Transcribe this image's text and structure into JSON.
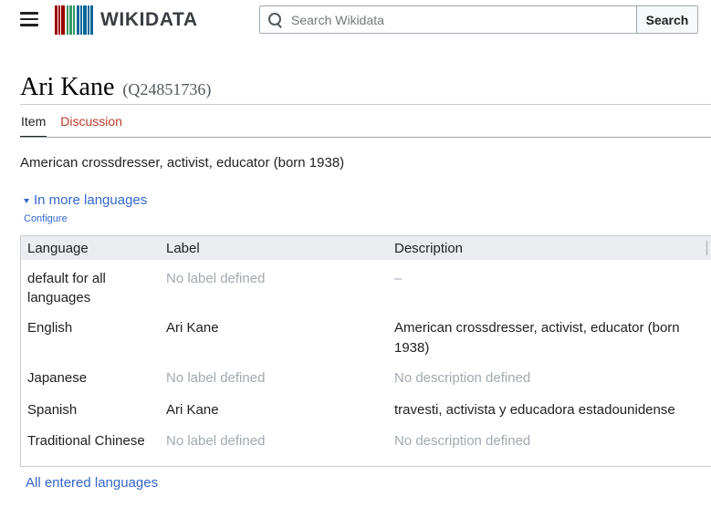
{
  "header": {
    "logo_text": "WIKIDATA",
    "logo_bar_colors": [
      "#990000",
      "#339966",
      "#006699"
    ],
    "search": {
      "placeholder": "Search Wikidata",
      "value": "",
      "button_label": "Search"
    }
  },
  "item": {
    "label": "Ari Kane",
    "id": "(Q24851736)",
    "description": "American crossdresser, activist, educator (born 1938)"
  },
  "tabs": [
    {
      "label": "Item",
      "active": true
    },
    {
      "label": "Discussion",
      "active": false
    }
  ],
  "languages": {
    "toggle_label": "In more languages",
    "configure_label": "Configure",
    "columns": [
      "Language",
      "Label",
      "Description"
    ],
    "rows": [
      {
        "language": "default for all",
        "language_line2": "languages",
        "label": "No label defined",
        "description": "–"
      },
      {
        "language": "English",
        "label": "Ari Kane",
        "description": "American crossdresser, activist, educator (born",
        "description_line2": "1938)"
      },
      {
        "language": "Japanese",
        "label": "No label defined",
        "description": "No description defined"
      },
      {
        "language": "Spanish",
        "label": "Ari Kane",
        "description": "travesti, activista y educadora estadounidense"
      },
      {
        "language": "Traditional Chinese",
        "label": "No label defined",
        "description": "No description defined"
      }
    ],
    "all_languages_label": "All entered languages"
  },
  "colors": {
    "link": "#3366cc",
    "discussion_tab": "#ba3b2a",
    "muted_text": "#a2a9b1"
  }
}
